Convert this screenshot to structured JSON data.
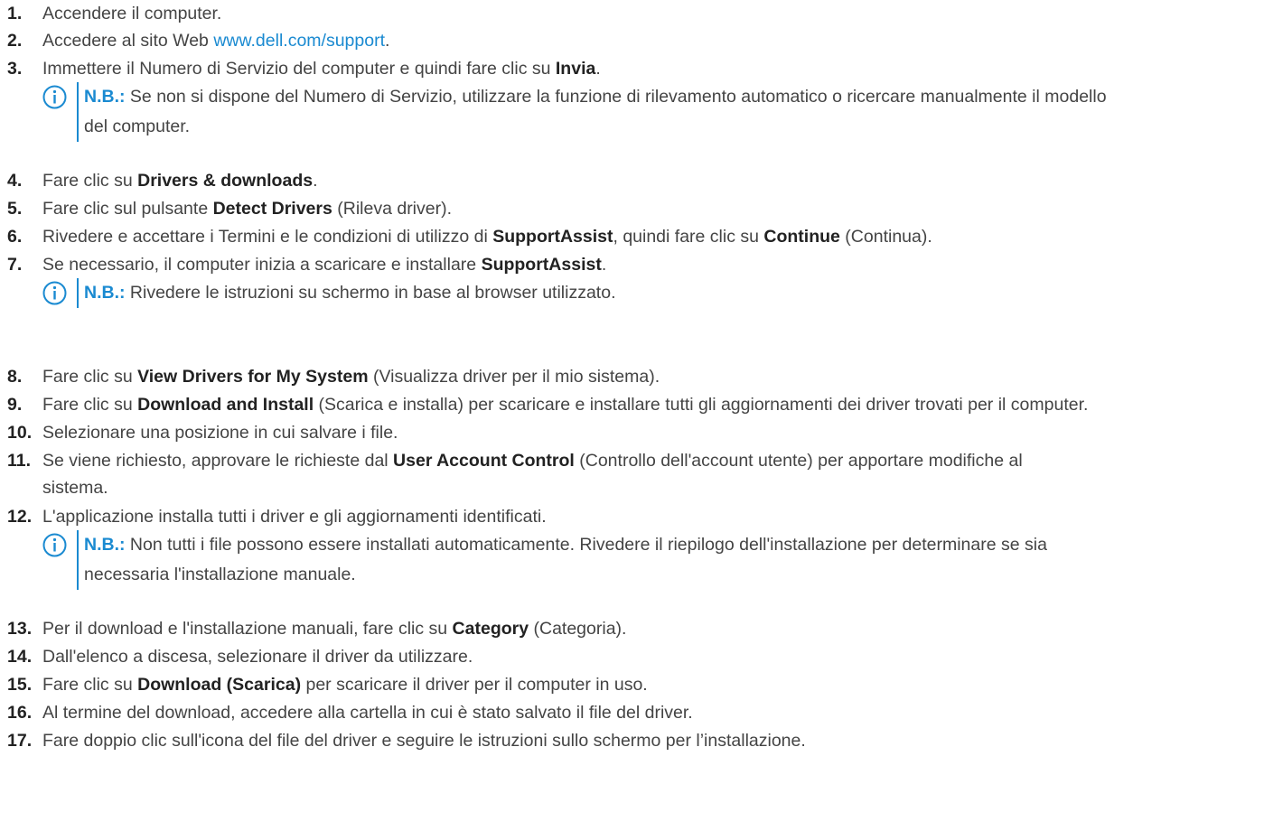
{
  "steps": [
    {
      "num": "1.",
      "parts": [
        {
          "t": "Accendere il computer."
        }
      ]
    },
    {
      "num": "2.",
      "parts": [
        {
          "t": "Accedere al sito Web "
        },
        {
          "t": "www.dell.com/support",
          "link": true
        },
        {
          "t": "."
        }
      ]
    },
    {
      "num": "3.",
      "parts": [
        {
          "t": "Immettere il Numero di Servizio del computer e quindi fare clic su "
        },
        {
          "t": "Invia",
          "bold": true
        },
        {
          "t": "."
        }
      ],
      "note": {
        "label": "N.B.:",
        "lines": [
          "Se non si dispone del Numero di Servizio, utilizzare la funzione di rilevamento automatico o ricercare manualmente il modello",
          "del computer."
        ]
      }
    },
    {
      "num": "4.",
      "parts": [
        {
          "t": "Fare clic su "
        },
        {
          "t": "Drivers & downloads",
          "bold": true
        },
        {
          "t": "."
        }
      ]
    },
    {
      "num": "5.",
      "parts": [
        {
          "t": "Fare clic sul pulsante "
        },
        {
          "t": "Detect Drivers",
          "bold": true
        },
        {
          "t": " (Rileva driver)."
        }
      ]
    },
    {
      "num": "6.",
      "parts": [
        {
          "t": "Rivedere e accettare i Termini e le condizioni di utilizzo di "
        },
        {
          "t": "SupportAssist",
          "bold": true
        },
        {
          "t": ", quindi fare clic su "
        },
        {
          "t": "Continue",
          "bold": true
        },
        {
          "t": " (Continua)."
        }
      ]
    },
    {
      "num": "7.",
      "parts": [
        {
          "t": "Se necessario, il computer inizia a scaricare e installare "
        },
        {
          "t": "SupportAssist",
          "bold": true
        },
        {
          "t": "."
        }
      ],
      "note": {
        "label": "N.B.:",
        "lines": [
          "Rivedere le istruzioni su schermo in base al browser utilizzato."
        ]
      }
    },
    {
      "num": "8.",
      "parts": [
        {
          "t": "Fare clic su "
        },
        {
          "t": "View Drivers for My System",
          "bold": true
        },
        {
          "t": " (Visualizza driver per il mio sistema)."
        }
      ]
    },
    {
      "num": "9.",
      "parts": [
        {
          "t": "Fare clic su "
        },
        {
          "t": "Download and Install",
          "bold": true
        },
        {
          "t": " (Scarica e installa) per scaricare e installare tutti gli aggiornamenti dei driver trovati per il computer."
        }
      ]
    },
    {
      "num": "10.",
      "parts": [
        {
          "t": "Selezionare una posizione in cui salvare i file."
        }
      ]
    },
    {
      "num": "11.",
      "parts": [
        {
          "t": "Se viene richiesto, approvare le richieste dal "
        },
        {
          "t": "User Account Control",
          "bold": true
        },
        {
          "t": " (Controllo dell'account utente) per apportare modifiche al"
        }
      ],
      "continuation": "sistema."
    },
    {
      "num": "12.",
      "parts": [
        {
          "t": "L'applicazione installa tutti i driver e gli aggiornamenti identificati."
        }
      ],
      "note": {
        "label": "N.B.:",
        "lines": [
          "Non tutti i file possono essere installati automaticamente. Rivedere il riepilogo dell'installazione per determinare se sia",
          "necessaria l'installazione manuale."
        ]
      }
    },
    {
      "num": "13.",
      "parts": [
        {
          "t": "Per il download e l'installazione manuali, fare clic su "
        },
        {
          "t": "Category",
          "bold": true
        },
        {
          "t": " (Categoria)."
        }
      ]
    },
    {
      "num": "14.",
      "parts": [
        {
          "t": "Dall'elenco a discesa, selezionare il driver da utilizzare."
        }
      ]
    },
    {
      "num": "15.",
      "parts": [
        {
          "t": "Fare clic su "
        },
        {
          "t": "Download (Scarica)",
          "bold": true
        },
        {
          "t": " per scaricare il driver per il computer in uso."
        }
      ]
    },
    {
      "num": "16.",
      "parts": [
        {
          "t": "Al termine del download, accedere alla cartella in cui è stato salvato il file del driver."
        }
      ]
    },
    {
      "num": "17.",
      "parts": [
        {
          "t": "Fare doppio clic sull'icona del file del driver e seguire le istruzioni sullo schermo per l’installazione."
        }
      ]
    }
  ],
  "colors": {
    "accent": "#1a8ad1",
    "text": "#444444",
    "number": "#222222"
  },
  "note_icon": "info-circle-icon"
}
